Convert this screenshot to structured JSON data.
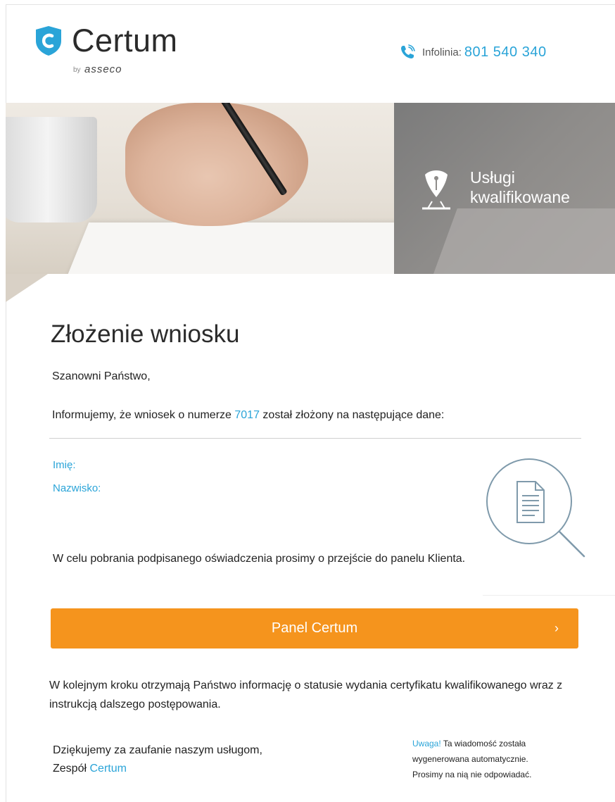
{
  "header": {
    "brand": "Certum",
    "brand_by": "by",
    "brand_parent": "asseco",
    "hotline_label": "Infolinia:",
    "hotline_number": "801 540 340",
    "accent_color": "#2aa4d8"
  },
  "banner": {
    "title_line1": "Usługi",
    "title_line2": "kwalifikowane"
  },
  "content": {
    "heading": "Złożenie wniosku",
    "greeting": "Szanowni Państwo,",
    "info_prefix": "Informujemy, że wniosek o numerze",
    "request_number": "7017",
    "info_suffix": "został złożony na następujące dane:",
    "fields": [
      {
        "label": "Imię:"
      },
      {
        "label": "Nazwisko:"
      }
    ],
    "download_text": "W celu pobrania podpisanego oświadczenia prosimy o przejście do panelu Klienta.",
    "button_label": "Panel Certum",
    "button_chevron": "›",
    "button_color": "#f5941d",
    "next_step_text": "W kolejnym kroku otrzymają Państwo informację o statusie wydania certyfikatu kwalifikowanego wraz z instrukcją dalszego postępowania.",
    "thanks_line1": "Dziękujemy za zaufanie naszym usługom,",
    "thanks_team_prefix": "Zespół",
    "thanks_team_brand": "Certum",
    "note_warning": "Uwaga!",
    "note_text_1": "Ta wiadomość została",
    "note_text_2": "wygenerowana automatycznie.",
    "note_text_3": "Prosimy na nią nie odpowiadać."
  }
}
